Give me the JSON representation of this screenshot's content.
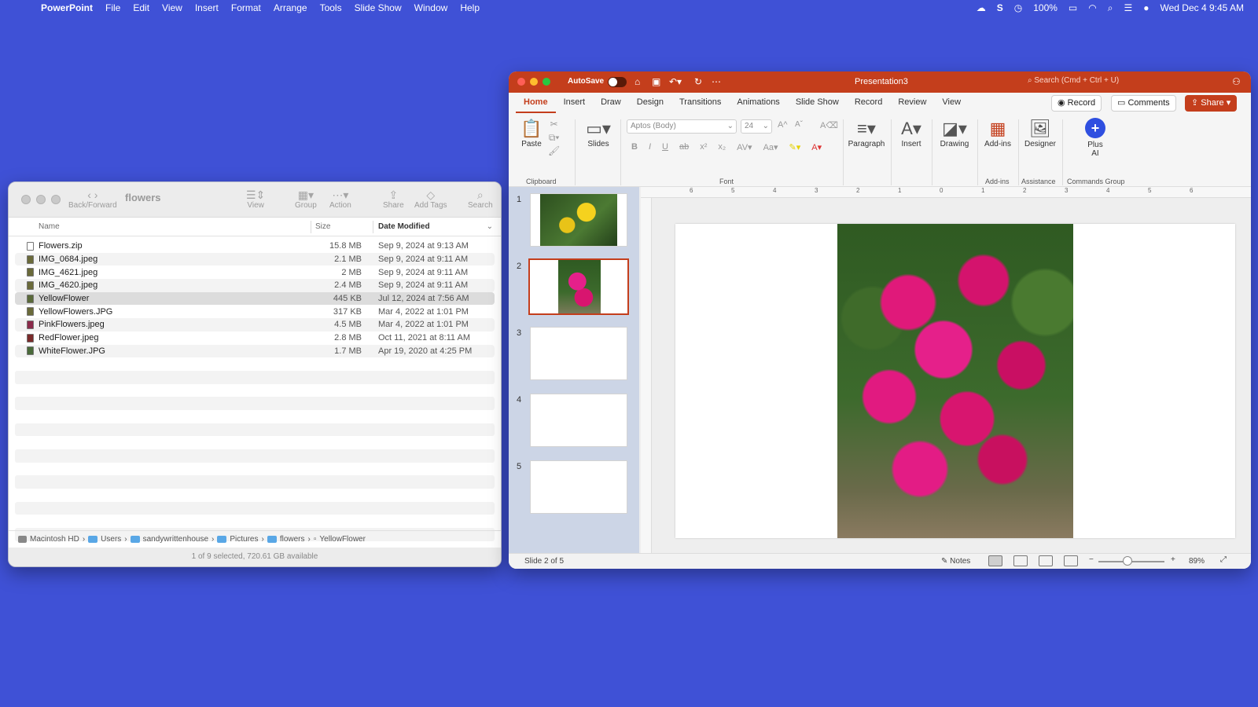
{
  "menubar": {
    "app_name": "PowerPoint",
    "items": [
      "File",
      "Edit",
      "View",
      "Insert",
      "Format",
      "Arrange",
      "Tools",
      "Slide Show",
      "Window",
      "Help"
    ],
    "battery": "100%",
    "datetime": "Wed Dec 4  9:45 AM"
  },
  "finder": {
    "title": "flowers",
    "toolbar": {
      "back_forward": "Back/Forward",
      "view": "View",
      "group": "Group",
      "action": "Action",
      "share": "Share",
      "add_tags": "Add Tags",
      "search": "Search"
    },
    "columns": {
      "name": "Name",
      "size": "Size",
      "date": "Date Modified"
    },
    "files": [
      {
        "name": "Flowers.zip",
        "size": "15.8 MB",
        "date": "Sep 9, 2024 at 9:13 AM"
      },
      {
        "name": "IMG_0684.jpeg",
        "size": "2.1 MB",
        "date": "Sep 9, 2024 at 9:11 AM"
      },
      {
        "name": "IMG_4621.jpeg",
        "size": "2 MB",
        "date": "Sep 9, 2024 at 9:11 AM"
      },
      {
        "name": "IMG_4620.jpeg",
        "size": "2.4 MB",
        "date": "Sep 9, 2024 at 9:11 AM"
      },
      {
        "name": "YellowFlower",
        "size": "445 KB",
        "date": "Jul 12, 2024 at 7:56 AM"
      },
      {
        "name": "YellowFlowers.JPG",
        "size": "317 KB",
        "date": "Mar 4, 2022 at 1:01 PM"
      },
      {
        "name": "PinkFlowers.jpeg",
        "size": "4.5 MB",
        "date": "Mar 4, 2022 at 1:01 PM"
      },
      {
        "name": "RedFlower.jpeg",
        "size": "2.8 MB",
        "date": "Oct 11, 2021 at 8:11 AM"
      },
      {
        "name": "WhiteFlower.JPG",
        "size": "1.7 MB",
        "date": "Apr 19, 2020 at 4:25 PM"
      }
    ],
    "path": [
      "Macintosh HD",
      "Users",
      "sandywrittenhouse",
      "Pictures",
      "flowers",
      "YellowFlower"
    ],
    "status": "1 of 9 selected, 720.61 GB available"
  },
  "powerpoint": {
    "autosave_label": "AutoSave",
    "doc_title": "Presentation3",
    "search_placeholder": "Search (Cmd + Ctrl + U)",
    "tabs": [
      "Home",
      "Insert",
      "Draw",
      "Design",
      "Transitions",
      "Animations",
      "Slide Show",
      "Record",
      "Review",
      "View"
    ],
    "record_label": "Record",
    "comments_label": "Comments",
    "share_label": "Share",
    "ribbon": {
      "paste": "Paste",
      "slides": "Slides",
      "font_name": "Aptos (Body)",
      "font_size": "24",
      "paragraph": "Paragraph",
      "insert": "Insert",
      "drawing": "Drawing",
      "add_ins": "Add-ins",
      "designer": "Designer",
      "plus_ai": "Plus AI",
      "group_clipboard": "Clipboard",
      "group_font": "Font",
      "group_add_ins": "Add-ins",
      "group_assistance": "Assistance",
      "group_commands": "Commands Group"
    },
    "slide_numbers": [
      "1",
      "2",
      "3",
      "4",
      "5"
    ],
    "ruler_numbers": [
      "6",
      "5",
      "4",
      "3",
      "2",
      "1",
      "0",
      "1",
      "2",
      "3",
      "4",
      "5",
      "6"
    ],
    "status": {
      "slide_indicator": "Slide 2 of 5",
      "notes": "Notes",
      "zoom": "89%"
    }
  }
}
